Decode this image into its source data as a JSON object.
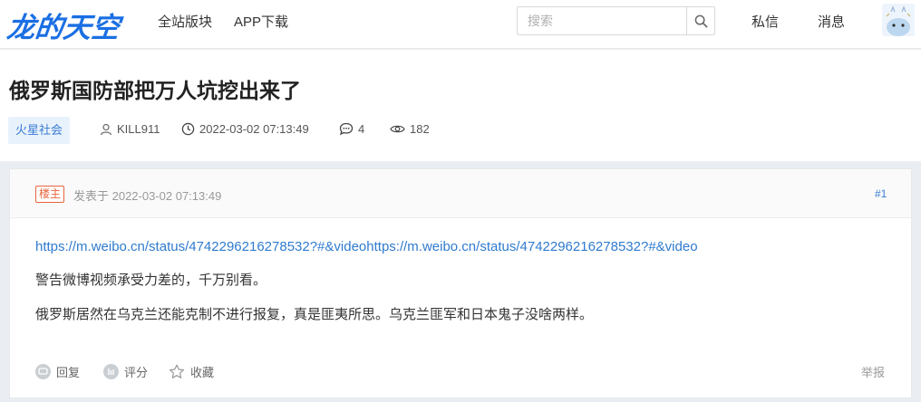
{
  "topbar": {
    "logo": "龙的天空",
    "nav": [
      "全站版块",
      "APP下载"
    ],
    "search_placeholder": "搜索",
    "messages": "私信",
    "notifications": "消息"
  },
  "thread": {
    "title": "俄罗斯国防部把万人坑挖出来了",
    "tag": "火星社会",
    "author": "KILL911",
    "date": "2022-03-02 07:13:49",
    "comments": "4",
    "views": "182"
  },
  "post": {
    "badge": "楼主",
    "posted": "发表于 2022-03-02 07:13:49",
    "floor": "#1",
    "link": "https://m.weibo.cn/status/4742296216278532?#&videohttps://m.weibo.cn/status/4742296216278532?#&video",
    "paragraphs": [
      "警告微博视频承受力差的，千万别看。",
      "俄罗斯居然在乌克兰还能克制不进行报复，真是匪夷所思。乌克兰匪军和日本鬼子没啥两样。"
    ],
    "actions": {
      "reply": "回复",
      "rate": "评分",
      "favorite": "收藏",
      "report": "举报"
    }
  },
  "colors": {
    "brand": "#1a6fe3",
    "link": "#2f7bcf",
    "badge": "#e8643c",
    "tag_bg": "#e8f2fc"
  }
}
